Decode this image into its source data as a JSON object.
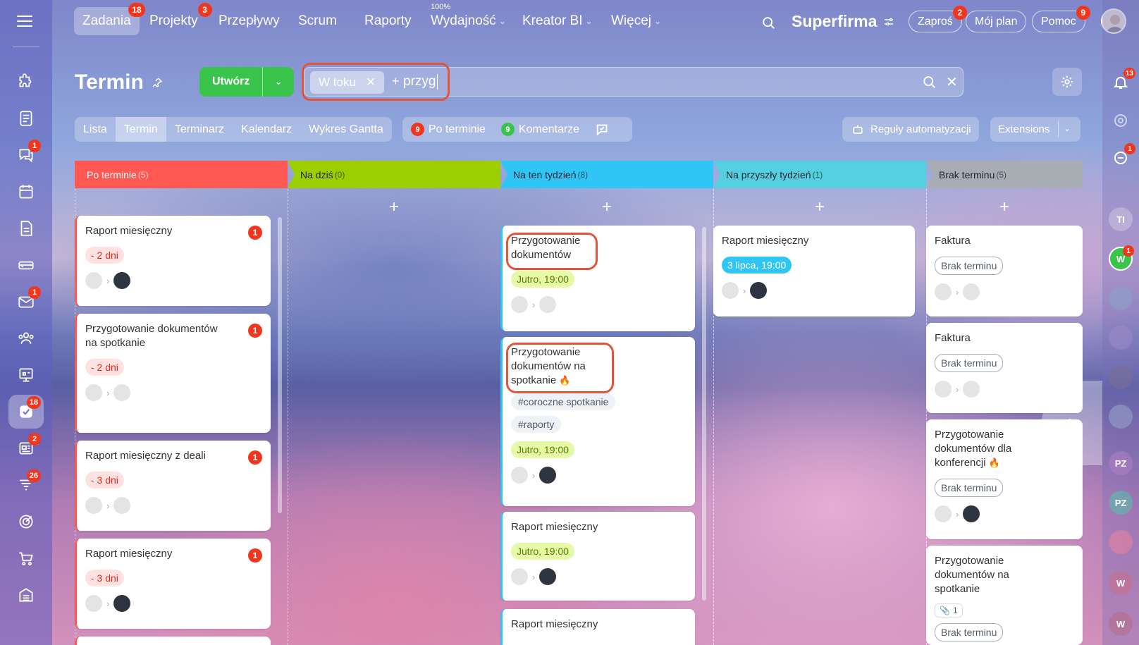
{
  "topnav": [
    {
      "label": "Zadania",
      "badge": "18",
      "active": true
    },
    {
      "label": "Projekty",
      "badge": "3"
    },
    {
      "label": "Przepływy"
    },
    {
      "label": "Scrum"
    },
    {
      "label": "Raporty"
    },
    {
      "label": "Wydajność",
      "sup": "100%"
    },
    {
      "label": "Kreator BI"
    },
    {
      "label": "Więcej"
    }
  ],
  "header": {
    "brand": "Superfirma",
    "invite": "Zaproś",
    "invite_badge": "2",
    "myplan": "Mój plan",
    "help": "Pomoc",
    "help_badge": "9"
  },
  "page": {
    "title": "Termin",
    "create_label": "Utwórz"
  },
  "search": {
    "chip": "W toku",
    "text": "przyg"
  },
  "views": [
    "Lista",
    "Termin",
    "Terminarz",
    "Kalendarz",
    "Wykres Gantta"
  ],
  "counters": [
    {
      "count": "9",
      "label": "Po terminie",
      "color": "#f1361d"
    },
    {
      "count": "9",
      "label": "Komentarze",
      "color": "#3bc44b"
    }
  ],
  "automation": "Reguły automatyzacji",
  "extensions": "Extensions",
  "left_badges": {
    "chat": "1",
    "mail": "1",
    "tasks": "18",
    "news": "2",
    "crm": "26"
  },
  "right_sidebar": {
    "bell_badge": "13",
    "chat_badge": "1",
    "w_badge": "1",
    "w": "W",
    "ti": "TI",
    "pz": "PZ"
  },
  "columns": [
    {
      "title": "Po terminie",
      "count": "(5)",
      "color": "#ff5752"
    },
    {
      "title": "Na dziś",
      "count": "(0)",
      "color": "#9dcf00"
    },
    {
      "title": "Na ten tydzień",
      "count": "(8)",
      "color": "#2fc6f6"
    },
    {
      "title": "Na przyszły tydzień",
      "count": "(1)",
      "color": "#55d0e0"
    },
    {
      "title": "Brak terminu",
      "count": "(5)",
      "color": "#a8adb4"
    }
  ],
  "col1": [
    {
      "title": "Raport miesięczny",
      "badge": "1",
      "deadline": "- 2 dni"
    },
    {
      "title": "Przygotowanie dokumentów na spotkanie",
      "badge": "1",
      "deadline": "- 2 dni"
    },
    {
      "title": "Raport miesięczny z deali",
      "badge": "1",
      "deadline": "- 3 dni"
    },
    {
      "title": "Raport miesięczny",
      "badge": "1",
      "deadline": "- 3 dni"
    }
  ],
  "col3": [
    {
      "title": "Przygotowanie dokumentów",
      "deadline": "Jutro, 19:00"
    },
    {
      "title": "Przygotowanie dokumentów na spotkanie",
      "tags": [
        "#coroczne spotkanie",
        "#raporty"
      ],
      "deadline": "Jutro, 19:00"
    },
    {
      "title": "Raport miesięczny",
      "deadline": "Jutro, 19:00"
    },
    {
      "title": "Raport miesięczny"
    }
  ],
  "col4": [
    {
      "title": "Raport miesięczny",
      "deadline": "3 lipca, 19:00"
    }
  ],
  "col5": [
    {
      "title": "Faktura",
      "deadline": "Brak terminu"
    },
    {
      "title": "Faktura",
      "deadline": "Brak terminu"
    },
    {
      "title": "Przygotowanie dokumentów dla konferencji",
      "deadline": "Brak terminu"
    },
    {
      "title": "Przygotowanie dokumentów na spotkanie",
      "attach": "1",
      "deadline": "Brak terminu"
    }
  ]
}
